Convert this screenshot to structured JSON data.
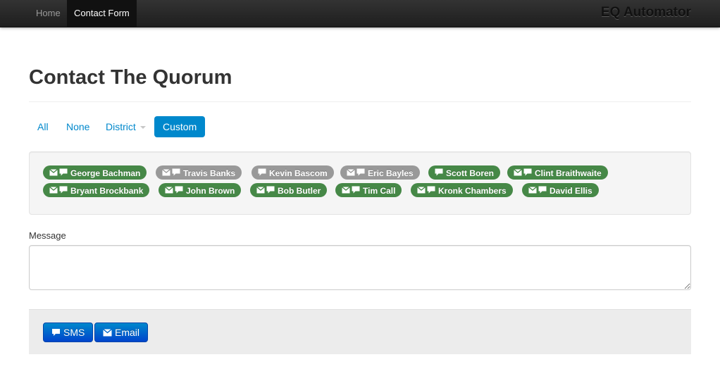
{
  "navbar": {
    "items": [
      {
        "label": "Home",
        "active": false
      },
      {
        "label": "Contact Form",
        "active": true
      }
    ],
    "brand": "EQ Automator"
  },
  "page": {
    "title": "Contact The Quorum"
  },
  "filters": {
    "items": [
      {
        "label": "All",
        "active": false
      },
      {
        "label": "None",
        "active": false
      },
      {
        "label": "District",
        "active": false,
        "dropdown": true
      },
      {
        "label": "Custom",
        "active": true
      }
    ]
  },
  "members": [
    {
      "name": "George Bachman",
      "selected": true,
      "icons": [
        "envelope-icon",
        "comment-icon"
      ]
    },
    {
      "name": "Travis Banks",
      "selected": false,
      "icons": [
        "envelope-icon",
        "comment-icon"
      ]
    },
    {
      "name": "Kevin Bascom",
      "selected": false,
      "icons": [
        "comment-icon"
      ]
    },
    {
      "name": "Eric Bayles",
      "selected": false,
      "icons": [
        "envelope-icon",
        "comment-icon"
      ]
    },
    {
      "name": "Scott Boren",
      "selected": true,
      "icons": [
        "comment-icon"
      ]
    },
    {
      "name": "Clint Braithwaite",
      "selected": true,
      "icons": [
        "envelope-icon",
        "comment-icon"
      ]
    },
    {
      "name": "Bryant Brockbank",
      "selected": true,
      "icons": [
        "envelope-icon",
        "comment-icon"
      ]
    },
    {
      "name": "John Brown",
      "selected": true,
      "icons": [
        "envelope-icon",
        "comment-icon"
      ]
    },
    {
      "name": "Bob Butler",
      "selected": true,
      "icons": [
        "envelope-icon",
        "comment-icon"
      ]
    },
    {
      "name": "Tim Call",
      "selected": true,
      "icons": [
        "envelope-icon",
        "comment-icon"
      ]
    },
    {
      "name": "Kronk Chambers",
      "selected": true,
      "icons": [
        "envelope-icon",
        "comment-icon"
      ]
    },
    {
      "name": "David Ellis",
      "selected": true,
      "icons": [
        "envelope-icon",
        "comment-icon"
      ]
    }
  ],
  "message": {
    "label": "Message",
    "value": "",
    "placeholder": ""
  },
  "actions": {
    "sms_label": "SMS",
    "email_label": "Email"
  },
  "colors": {
    "selected_badge": "#468847",
    "unselected_badge": "#999999",
    "primary": "#0088cc",
    "navbar": "#222222"
  }
}
